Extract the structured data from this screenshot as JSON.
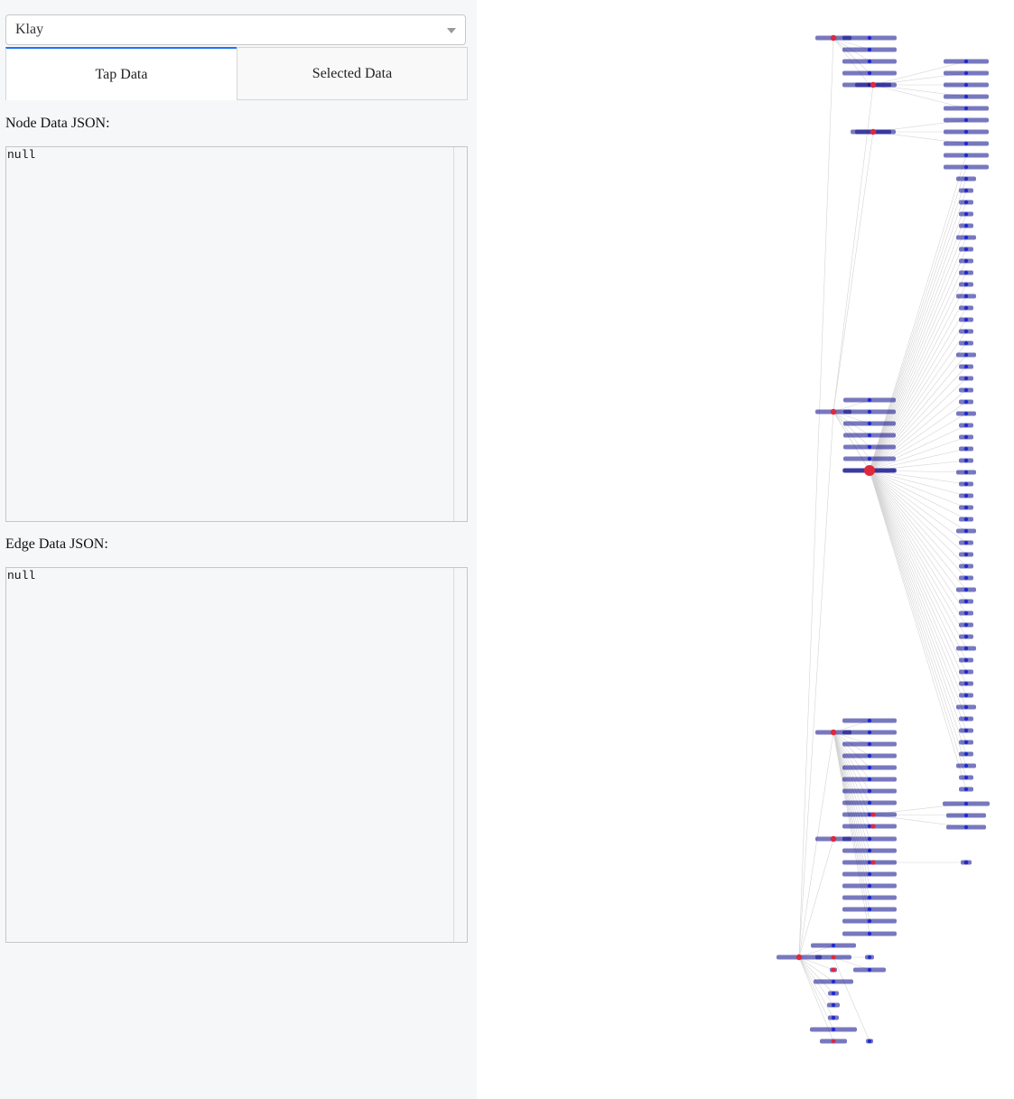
{
  "layout_dropdown": {
    "selected": "Klay"
  },
  "tabs": [
    {
      "label": "Tap Data",
      "active": true
    },
    {
      "label": "Selected Data",
      "active": false
    }
  ],
  "node_section": {
    "label": "Node Data JSON:",
    "value": "null"
  },
  "edge_section": {
    "label": "Edge Data JSON:",
    "value": "null"
  },
  "colors": {
    "accent": "#1975fa",
    "node_blue": "#1f2bd1",
    "node_red": "#e0283c",
    "edge": "#d4d4d4",
    "label_text": "#0a0a8a"
  }
}
